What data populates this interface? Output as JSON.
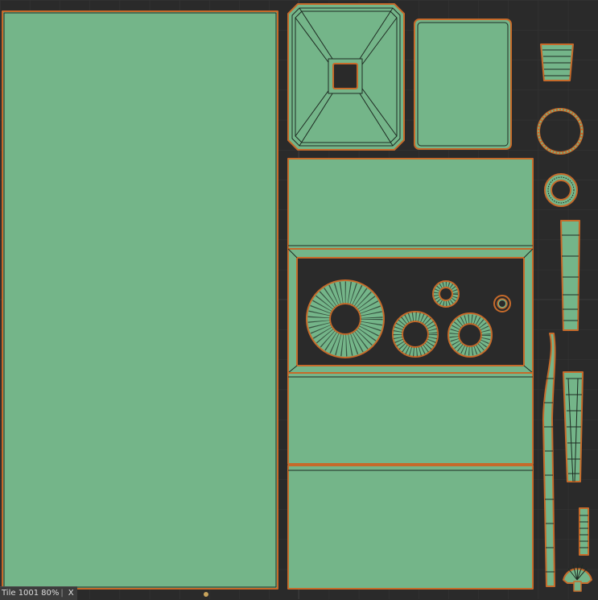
{
  "status_bar": {
    "tile_label": "Tile 1001",
    "zoom": "80%",
    "separator": "|",
    "close_label": "X"
  },
  "colors": {
    "background": "#2a2a2a",
    "grid_line": "#383838",
    "uv_fill": "#74b589",
    "uv_border": "#c66a2a",
    "wire": "#1e2a22"
  }
}
